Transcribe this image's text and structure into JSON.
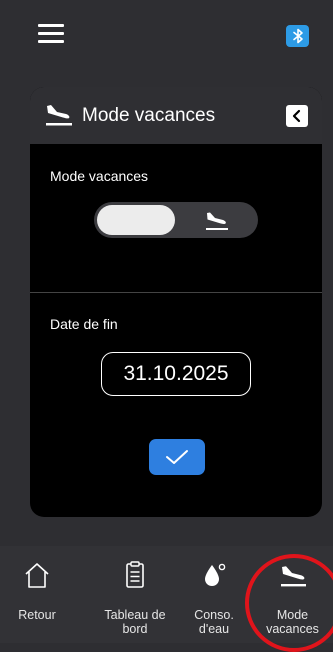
{
  "topbar": {
    "menu_icon": "hamburger-icon",
    "bluetooth_icon": "bluetooth-icon",
    "bluetooth_color": "#2d9be6"
  },
  "card": {
    "title": "Mode vacances",
    "title_icon": "airplane-landing-icon",
    "back_icon": "chevron-left-icon",
    "vacation_mode": {
      "label": "Mode vacances",
      "toggle_state": "off",
      "toggle_icon": "airplane-landing-icon"
    },
    "end_date": {
      "label": "Date de fin",
      "value": "31.10.2025"
    },
    "confirm_icon": "checkmark-icon",
    "confirm_color": "#2e7fe0"
  },
  "bottom_nav": {
    "items": [
      {
        "label": "Retour",
        "icon": "home-icon"
      },
      {
        "label": "Tableau de bord",
        "icon": "clipboard-icon"
      },
      {
        "label": "Conso. d'eau",
        "icon": "water-drop-icon"
      },
      {
        "label": "Mode vacances",
        "icon": "airplane-landing-icon"
      }
    ],
    "highlight_color": "#e0141b"
  }
}
